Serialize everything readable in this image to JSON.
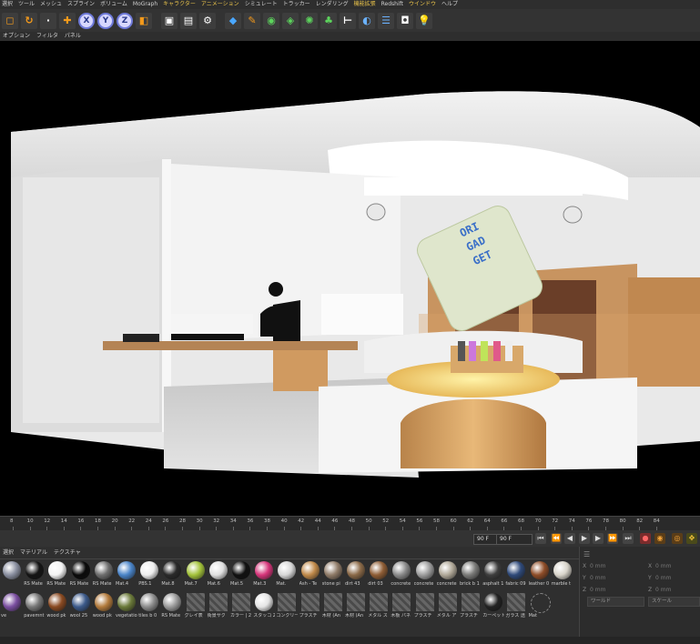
{
  "menu": [
    "選択",
    "ツール",
    "メッシュ",
    "スプライン",
    "ボリューム",
    "MoGraph",
    "キャラクター",
    "アニメーション",
    "シミュレート",
    "トラッカー",
    "レンダリング",
    "機能拡張",
    "Redshift",
    "ウインドウ",
    "ヘルプ"
  ],
  "submenu": [
    "オプション",
    "フィルタ",
    "パネル"
  ],
  "scene": {
    "brand_lines": [
      "ORI",
      "GAD",
      "GET"
    ]
  },
  "timeline": {
    "ticks": [
      "8",
      "10",
      "12",
      "14",
      "16",
      "18",
      "20",
      "22",
      "24",
      "26",
      "28",
      "30",
      "32",
      "34",
      "36",
      "38",
      "40",
      "42",
      "44",
      "46",
      "48",
      "50",
      "52",
      "54",
      "56",
      "58",
      "60",
      "62",
      "64",
      "66",
      "68",
      "70",
      "72",
      "74",
      "76",
      "78",
      "80",
      "82",
      "84"
    ]
  },
  "transport": {
    "current_frame": "90 F",
    "end_frame": "90 F"
  },
  "material_menu": [
    "選択",
    "マテリアル",
    "テクスチャ"
  ],
  "materials_row1": [
    {
      "label": "",
      "color": "#8a8fa0"
    },
    {
      "label": "RS Mate",
      "color": "#151515"
    },
    {
      "label": "RS Mate",
      "color": "#f4f4f4"
    },
    {
      "label": "RS Mate",
      "color": "#0a0a0a"
    },
    {
      "label": "RS Mate",
      "color": "#6e6e6e"
    },
    {
      "label": "Mat.4",
      "color": "#4a84c8"
    },
    {
      "label": "PBS.1",
      "color": "#eeeeee"
    },
    {
      "label": "Mat.8",
      "color": "#2a2a2a"
    },
    {
      "label": "Mat.7",
      "color": "#a3c23a"
    },
    {
      "label": "Mat.6",
      "color": "#e0e0e0"
    },
    {
      "label": "Mat.5",
      "color": "#111111"
    },
    {
      "label": "Mat.3",
      "color": "#d6357a"
    },
    {
      "label": "Mat.",
      "color": "#d8d8d8"
    },
    {
      "label": "Ash - Te",
      "color": "#c08a4a"
    },
    {
      "label": "stone pi",
      "color": "#8f7b68"
    },
    {
      "label": "dirt 43",
      "color": "#8b6a48"
    },
    {
      "label": "dirt 03",
      "color": "#8e5d35"
    },
    {
      "label": "concrete",
      "color": "#8a8a8a"
    },
    {
      "label": "concrete",
      "color": "#9d9d9d"
    },
    {
      "label": "concrete",
      "color": "#b0a898"
    },
    {
      "label": "brick b 1",
      "color": "#7a7a78"
    },
    {
      "label": "asphalt 1",
      "color": "#3e3e3e"
    },
    {
      "label": "fabric 09",
      "color": "#2f4a7a"
    },
    {
      "label": "leather 0",
      "color": "#8e4d28"
    },
    {
      "label": "marble t",
      "color": "#d8d4ca"
    }
  ],
  "materials_row2": [
    {
      "label": "ve",
      "color": "#7a4ea0"
    },
    {
      "label": "pavemnt",
      "color": "#777"
    },
    {
      "label": "wood pk",
      "color": "#8a4a22"
    },
    {
      "label": "wool 25",
      "color": "#3c5a8a"
    },
    {
      "label": "wood pk",
      "color": "#b27a3c"
    },
    {
      "label": "vegetatio",
      "color": "#6b7a3a"
    },
    {
      "label": "tiles b 0",
      "color": "#8c8c8c"
    },
    {
      "label": "RS Mate",
      "color": "#9a9a9a"
    },
    {
      "label": "グレイ表",
      "color": "striped"
    },
    {
      "label": "街景サク",
      "color": "striped"
    },
    {
      "label": "カラー | 2",
      "color": "striped"
    },
    {
      "label": "スタッコ 2",
      "color": "#e4e4e4"
    },
    {
      "label": "コンクリー",
      "color": "striped"
    },
    {
      "label": "プラスチ",
      "color": "striped"
    },
    {
      "label": "木材 (An",
      "color": "striped"
    },
    {
      "label": "木材 (An",
      "color": "striped"
    },
    {
      "label": "メタル ス",
      "color": "striped"
    },
    {
      "label": "木板 パネ",
      "color": "striped"
    },
    {
      "label": "プラスチ",
      "color": "striped"
    },
    {
      "label": "メタル ア",
      "color": "striped"
    },
    {
      "label": "プラスチ",
      "color": "striped"
    },
    {
      "label": "カーペット",
      "color": "#222"
    },
    {
      "label": "ガラス 透",
      "color": "striped"
    },
    {
      "label": "Mat",
      "color": "outline"
    }
  ],
  "coords": {
    "x_label": "X",
    "y_label": "Y",
    "z_label": "Z",
    "x_val": "0 mm",
    "y_val": "0 mm",
    "z_val": "0 mm",
    "x2_val": "0 mm",
    "y2_val": "0 mm",
    "z2_val": "0 mm",
    "world": "ワールド",
    "scale": "スケール"
  }
}
